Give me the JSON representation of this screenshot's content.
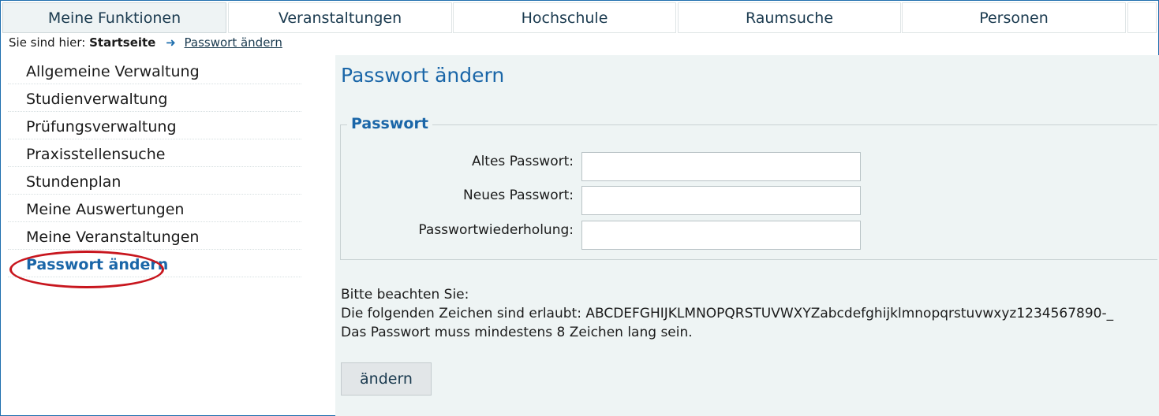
{
  "nav": {
    "tabs": [
      {
        "label": "Meine Funktionen",
        "active": true
      },
      {
        "label": "Veranstaltungen",
        "active": false
      },
      {
        "label": "Hochschule",
        "active": false
      },
      {
        "label": "Raumsuche",
        "active": false
      },
      {
        "label": "Personen",
        "active": false
      }
    ]
  },
  "breadcrumb": {
    "prefix": "Sie sind hier:",
    "current": "Startseite",
    "arrow_icon": "arrow-right-icon",
    "link": "Passwort ändern"
  },
  "sidebar": {
    "items": [
      {
        "label": "Allgemeine Verwaltung",
        "active": false
      },
      {
        "label": "Studienverwaltung",
        "active": false
      },
      {
        "label": "Prüfungsverwaltung",
        "active": false
      },
      {
        "label": "Praxisstellensuche",
        "active": false
      },
      {
        "label": "Stundenplan",
        "active": false
      },
      {
        "label": "Meine Auswertungen",
        "active": false
      },
      {
        "label": "Meine Veranstaltungen",
        "active": false
      },
      {
        "label": "Passwort ändern",
        "active": true
      },
      {
        "label": "",
        "active": false
      }
    ]
  },
  "main": {
    "title": "Passwort ändern",
    "fieldset_legend": "Passwort",
    "fields": [
      {
        "label": "Altes Passwort:",
        "value": ""
      },
      {
        "label": "Neues Passwort:",
        "value": ""
      },
      {
        "label": "Passwortwiederholung:",
        "value": ""
      }
    ],
    "notes": [
      "Bitte beachten Sie:",
      "Die folgenden Zeichen sind erlaubt: ABCDEFGHIJKLMNOPQRSTUVWXYZabcdefghijklmnopqrstuvwxyz1234567890-_",
      "Das Passwort muss mindestens 8 Zeichen lang sein."
    ],
    "submit_label": "ändern"
  },
  "colors": {
    "accent": "#1a66a8",
    "highlight": "#c8161e",
    "content_bg": "#eef4f4"
  }
}
